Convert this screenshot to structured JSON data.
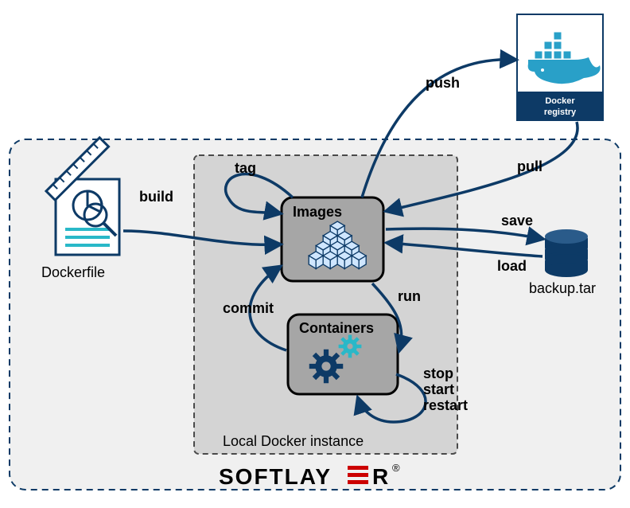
{
  "nodes": {
    "dockerfile": {
      "label": "Dockerfile"
    },
    "images": {
      "title": "Images"
    },
    "containers": {
      "title": "Containers"
    },
    "registry": {
      "line1": "Docker",
      "line2": "registry"
    },
    "backup": {
      "label": "backup.tar"
    },
    "localInstance": {
      "label": "Local Docker instance"
    }
  },
  "edges": {
    "build": "build",
    "tag": "tag",
    "push": "push",
    "pull": "pull",
    "save": "save",
    "load": "load",
    "run": "run",
    "commit": "commit",
    "stop": "stop",
    "start": "start",
    "restart": "restart"
  },
  "brand": {
    "full": "SOFTLAYER",
    "reg": "®"
  }
}
